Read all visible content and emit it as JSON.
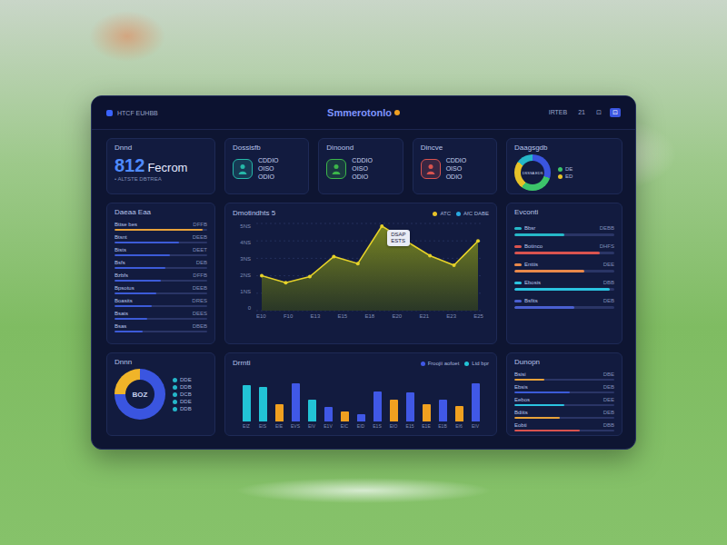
{
  "header": {
    "logo_text": "HTCF EUHBB",
    "title": "Smmerotonlo",
    "actions": [
      {
        "label": "IRTEB",
        "selected": false
      },
      {
        "label": "21",
        "selected": false
      },
      {
        "label": "⊡",
        "selected": false
      },
      {
        "label": "⊡",
        "selected": true
      }
    ]
  },
  "summary": {
    "label": "Dnnd",
    "value": "812",
    "unit": "Fecrom",
    "caption": "• ALTSTE DBTREA"
  },
  "kpis": [
    {
      "label": "Dossisfb",
      "lines": [
        "CDDIO",
        "OISO",
        "ODIO"
      ],
      "color": "#26b8a8"
    },
    {
      "label": "Dinoond",
      "lines": [
        "CDDIO",
        "OISO",
        "ODIO"
      ],
      "color": "#3cb64a"
    },
    {
      "label": "Dincve",
      "lines": [
        "CDDIO",
        "OISO",
        "ODIO"
      ],
      "color": "#d9534f"
    }
  ],
  "share_donut": {
    "label": "Daagsgdb",
    "center": "DSSSA EDS",
    "segments": [
      {
        "value": 30,
        "color": "#3a55e0"
      },
      {
        "value": 30,
        "color": "#3cc46a"
      },
      {
        "value": 25,
        "color": "#e6c229"
      },
      {
        "value": 15,
        "color": "#25b6c9"
      }
    ],
    "legend": [
      {
        "label": "DE",
        "color": "#3cc46a"
      },
      {
        "label": "ED",
        "color": "#e6c229"
      }
    ]
  },
  "ranking": {
    "title": "Daeaa Eaa",
    "rows": [
      {
        "label": "Bttse bes",
        "reading": "DFFB",
        "level": 0.95,
        "color": "#e8a23a"
      },
      {
        "label": "Btsnt",
        "reading": "DEEB",
        "level": 0.7,
        "color": "#3c5bd8"
      },
      {
        "label": "Bists",
        "reading": "DEET",
        "level": 0.6,
        "color": "#3c5bd8"
      },
      {
        "label": "Bsfs",
        "reading": "DEB",
        "level": 0.55,
        "color": "#3c5bd8"
      },
      {
        "label": "Bzbfs",
        "reading": "DFFB",
        "level": 0.5,
        "color": "#3c5bd8"
      },
      {
        "label": "Bpsotus",
        "reading": "DEEB",
        "level": 0.45,
        "color": "#3c5bd8"
      },
      {
        "label": "Boasits",
        "reading": "DRES",
        "level": 0.4,
        "color": "#3c5bd8"
      },
      {
        "label": "Bsats",
        "reading": "DEES",
        "level": 0.35,
        "color": "#3c5bd8"
      },
      {
        "label": "Bsas",
        "reading": "DBEB",
        "level": 0.3,
        "color": "#3c5bd8"
      }
    ]
  },
  "line_chart": {
    "title": "Dmotindhts 5",
    "legend": [
      {
        "label": "ATC",
        "color": "#e6c229"
      },
      {
        "label": "AfC DABE",
        "color": "#29a9e0"
      }
    ],
    "y_ticks": [
      "5NS",
      "4NS",
      "3NS",
      "2NS",
      "1NS",
      "0"
    ],
    "y_max": 5,
    "x_labels": [
      "E10",
      "F10",
      "E13",
      "E15",
      "E18",
      "E20",
      "E21",
      "E23",
      "E25"
    ],
    "series": [
      {
        "name": "ATC",
        "values": [
          2.0,
          1.6,
          1.95,
          3.1,
          2.7,
          4.85,
          4.0,
          3.15,
          2.6,
          4.0
        ]
      }
    ],
    "tooltip": {
      "index": 5,
      "lines": [
        "DSAP",
        "ESTS"
      ]
    }
  },
  "events": {
    "title": "Evconti",
    "rows": [
      {
        "label": "Bbsr",
        "reading": "DEBB",
        "level": 0.5,
        "color": "#26b8c8"
      },
      {
        "label": "Botinco",
        "reading": "DHFS",
        "level": 0.85,
        "color": "#d9534f"
      },
      {
        "label": "Enttis",
        "reading": "DEE",
        "level": 0.7,
        "color": "#e8884a"
      },
      {
        "label": "Ebosis",
        "reading": "DBB",
        "level": 0.95,
        "color": "#2bc3e0"
      },
      {
        "label": "Bsfits",
        "reading": "DEB",
        "level": 0.6,
        "color": "#4a5fd0"
      }
    ]
  },
  "small_donut": {
    "label": "Dnnn",
    "center": "BOZ",
    "segments": [
      {
        "value": 75,
        "color": "#3a55e0"
      },
      {
        "value": 25,
        "color": "#f0b429"
      }
    ],
    "legend": [
      "DDE",
      "DDB",
      "DCB",
      "DDE",
      "DDB"
    ]
  },
  "bar_chart": {
    "title": "Drrnti",
    "legend": [
      {
        "label": "Froojii aofoet",
        "color": "#4058e6"
      },
      {
        "label": "Ltd bpr",
        "color": "#22c3d6"
      }
    ],
    "y_max": 100,
    "bars": [
      {
        "label": "EIZ",
        "value": 75,
        "color": "#22c3d6"
      },
      {
        "label": "EIS",
        "value": 70,
        "color": "#22c3d6"
      },
      {
        "label": "EIE",
        "value": 35,
        "color": "#f0a020"
      },
      {
        "label": "EVS",
        "value": 78,
        "color": "#4058e6"
      },
      {
        "label": "EIV",
        "value": 45,
        "color": "#22c3d6"
      },
      {
        "label": "E1V",
        "value": 30,
        "color": "#4058e6"
      },
      {
        "label": "EIC",
        "value": 20,
        "color": "#f0a020"
      },
      {
        "label": "EID",
        "value": 15,
        "color": "#4058e6"
      },
      {
        "label": "E1S",
        "value": 62,
        "color": "#4058e6"
      },
      {
        "label": "EIO",
        "value": 45,
        "color": "#f0a020"
      },
      {
        "label": "E15",
        "value": 60,
        "color": "#4058e6"
      },
      {
        "label": "E1E",
        "value": 35,
        "color": "#f0a020"
      },
      {
        "label": "E1B",
        "value": 45,
        "color": "#4058e6"
      },
      {
        "label": "EI6",
        "value": 32,
        "color": "#f0a020"
      },
      {
        "label": "EIV",
        "value": 78,
        "color": "#4058e6"
      }
    ]
  },
  "details": {
    "title": "Dunopn",
    "rows": [
      {
        "label": "Bsisi",
        "reading": "DBE",
        "level": 0.3,
        "color": "#e8a23a"
      },
      {
        "label": "Ebsis",
        "reading": "DEB",
        "level": 0.55,
        "color": "#3c5bd8"
      },
      {
        "label": "Eebos",
        "reading": "DEE",
        "level": 0.5,
        "color": "#2bc3e0"
      },
      {
        "label": "Bdiits",
        "reading": "DEB",
        "level": 0.45,
        "color": "#e8a23a"
      },
      {
        "label": "Eobti",
        "reading": "DBB",
        "level": 0.65,
        "color": "#d9534f"
      }
    ]
  }
}
